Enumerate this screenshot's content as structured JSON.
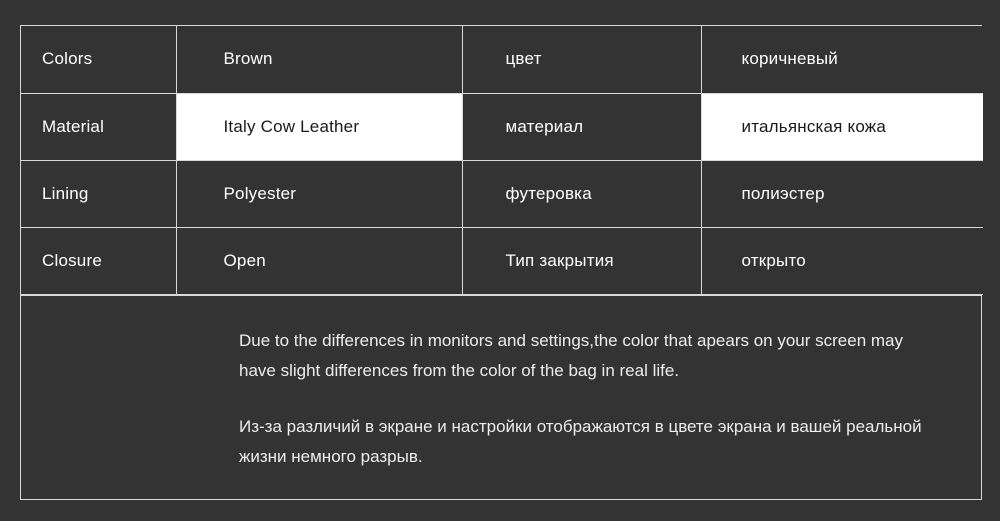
{
  "spec_table": {
    "rows": [
      {
        "label_en": "Colors",
        "value_en": "Brown",
        "label_ru": "цвет",
        "value_ru": "коричневый",
        "highlighted": false
      },
      {
        "label_en": "Material",
        "value_en": "Italy Cow Leather",
        "label_ru": "материал",
        "value_ru": "итальянская кожа",
        "highlighted": true
      },
      {
        "label_en": "Lining",
        "value_en": "Polyester",
        "label_ru": "футеровка",
        "value_ru": "полиэстер",
        "highlighted": false
      },
      {
        "label_en": "Closure",
        "value_en": "Open",
        "label_ru": "Тип закрытия",
        "value_ru": "открыто",
        "highlighted": false
      }
    ]
  },
  "notes": {
    "english": "Due to the differences in monitors and settings,the color that apears on your screen may have slight differences from the color of the bag in real life.",
    "russian": "Из-за различий в экране и настройки отображаются в цвете экрана и вашей реальной жизни немного разрыв."
  },
  "colors": {
    "background": "#333333",
    "border": "#d8d8d8",
    "text_light": "#ffffff",
    "text_dark": "#1a1a1a",
    "highlight_background": "#ffffff"
  }
}
